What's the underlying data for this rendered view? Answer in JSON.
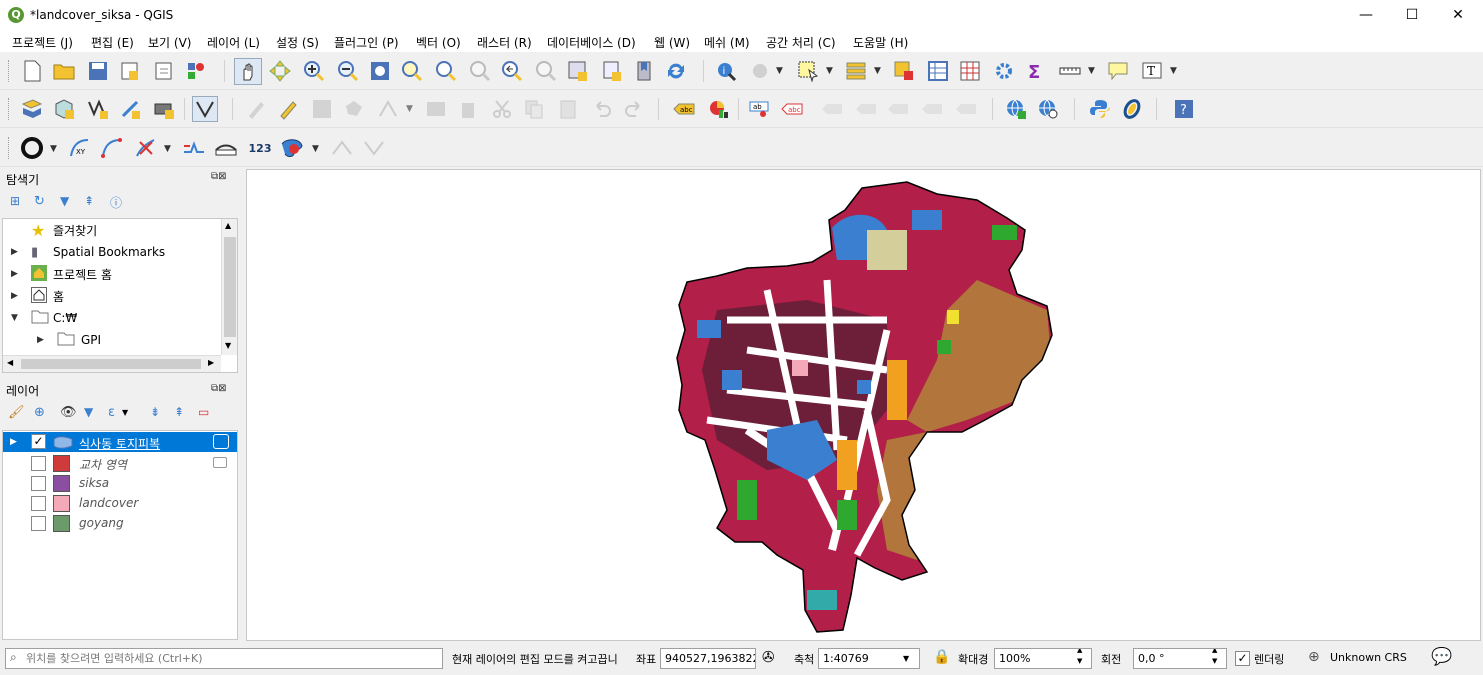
{
  "window": {
    "title": "*landcover_siksa - QGIS",
    "logo": "Q",
    "minimize": "—",
    "maximize": "☐",
    "close": "✕"
  },
  "menu": [
    "프로젝트 (J)",
    "편집 (E)",
    "보기 (V)",
    "레이어 (L)",
    "설정 (S)",
    "플러그인 (P)",
    "벡터 (O)",
    "래스터 (R)",
    "데이터베이스 (D)",
    "웹 (W)",
    "메쉬 (M)",
    "공간 처리 (C)",
    "도움말 (H)"
  ],
  "digitize_toolbar": {
    "label_123": "123"
  },
  "browser": {
    "title": "탐색기",
    "items": [
      {
        "label": "즐겨찾기",
        "icon": "star-icon"
      },
      {
        "label": "Spatial Bookmarks",
        "icon": "bookmark-icon"
      },
      {
        "label": "프로젝트 홈",
        "icon": "project-home-icon"
      },
      {
        "label": "홈",
        "icon": "home-icon"
      },
      {
        "label": "C:₩",
        "icon": "folder-icon"
      },
      {
        "label": "GPI",
        "icon": "folder-icon"
      }
    ]
  },
  "layers": {
    "title": "레이어",
    "items": [
      {
        "name": "식사동 토지피복",
        "checked": true,
        "selected": true,
        "color": "#6f9fd8"
      },
      {
        "name": "교차 영역",
        "checked": false,
        "color": "#cf3a3a"
      },
      {
        "name": "siksa",
        "checked": false,
        "color": "#8b4fa2"
      },
      {
        "name": "landcover",
        "checked": false,
        "color": "#f4a9b8"
      },
      {
        "name": "goyang",
        "checked": false,
        "color": "#6b9a6b"
      }
    ]
  },
  "status": {
    "locate_placeholder": "위치를 찾으려면 입력하세요 (Ctrl+K)",
    "message": "현재 레이어의 편집 모드를 켜고끕니",
    "coord_label": "좌표",
    "coord_value": "940527,1963822",
    "scale_label": "축척",
    "scale_value": "1:40769",
    "magnifier_label": "확대경",
    "magnifier_value": "100%",
    "rotation_label": "회전",
    "rotation_value": "0,0 °",
    "render_label": "렌더링",
    "render_checked": true,
    "crs": "Unknown CRS"
  },
  "colors": {
    "accent": "#0078d7",
    "map_red": "#b21f48",
    "map_brown": "#b2763d",
    "map_blue": "#3a7fd0",
    "map_green": "#2ea82e"
  }
}
